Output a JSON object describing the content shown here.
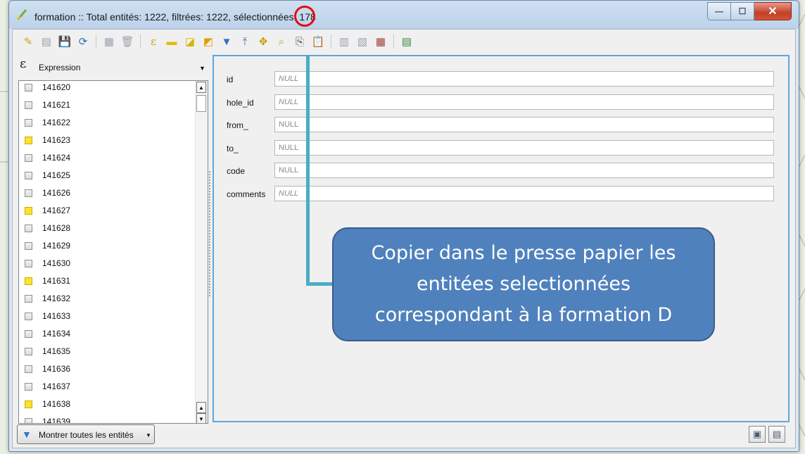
{
  "window": {
    "title": "formation :: Total entités: 1222, filtrées: 1222, sélectionnées: 178",
    "controls": {
      "minimize": "—",
      "maximize": "☐",
      "close": "✕"
    }
  },
  "toolbar": {
    "buttons": [
      {
        "name": "toggle-editing-icon",
        "glyph": "✎"
      },
      {
        "name": "multi-edit-icon",
        "glyph": "▤"
      },
      {
        "name": "save-edits-icon",
        "glyph": "💾"
      },
      {
        "name": "reload-icon",
        "glyph": "⟳"
      },
      {
        "name": "add-feature-icon",
        "glyph": "▦"
      },
      {
        "name": "delete-selected-icon",
        "glyph": "🗑"
      },
      {
        "name": "select-by-expression-icon",
        "glyph": "ε"
      },
      {
        "name": "select-all-icon",
        "glyph": "▬"
      },
      {
        "name": "invert-selection-icon",
        "glyph": "◪"
      },
      {
        "name": "deselect-all-icon",
        "glyph": "◩"
      },
      {
        "name": "filter-select-icon",
        "glyph": "▼"
      },
      {
        "name": "move-selection-to-top-icon",
        "glyph": "⤒"
      },
      {
        "name": "pan-map-to-selection-icon",
        "glyph": "✥"
      },
      {
        "name": "zoom-to-selection-icon",
        "glyph": "⌕"
      },
      {
        "name": "copy-selected-rows-icon",
        "glyph": "⎘"
      },
      {
        "name": "paste-features-icon",
        "glyph": "📋"
      },
      {
        "name": "new-field-icon",
        "glyph": "▥"
      },
      {
        "name": "delete-field-icon",
        "glyph": "▧"
      },
      {
        "name": "field-calculator-icon",
        "glyph": "▦"
      },
      {
        "name": "conditional-formatting-icon",
        "glyph": "▤"
      }
    ]
  },
  "left_panel": {
    "expression_label": "Expression",
    "items": [
      {
        "label": "141620",
        "selected": false
      },
      {
        "label": "141621",
        "selected": false
      },
      {
        "label": "141622",
        "selected": false
      },
      {
        "label": "141623",
        "selected": true
      },
      {
        "label": "141624",
        "selected": false
      },
      {
        "label": "141625",
        "selected": false
      },
      {
        "label": "141626",
        "selected": false
      },
      {
        "label": "141627",
        "selected": true
      },
      {
        "label": "141628",
        "selected": false
      },
      {
        "label": "141629",
        "selected": false
      },
      {
        "label": "141630",
        "selected": false
      },
      {
        "label": "141631",
        "selected": true
      },
      {
        "label": "141632",
        "selected": false
      },
      {
        "label": "141633",
        "selected": false
      },
      {
        "label": "141634",
        "selected": false
      },
      {
        "label": "141635",
        "selected": false
      },
      {
        "label": "141636",
        "selected": false
      },
      {
        "label": "141637",
        "selected": false
      },
      {
        "label": "141638",
        "selected": true
      },
      {
        "label": "141639",
        "selected": false
      }
    ]
  },
  "form": {
    "fields": [
      {
        "label": "id",
        "value": "NULL",
        "italic": true
      },
      {
        "label": "hole_id",
        "value": "NULL",
        "italic": true
      },
      {
        "label": "from_",
        "value": "NULL",
        "italic": false
      },
      {
        "label": "to_",
        "value": "NULL",
        "italic": false
      },
      {
        "label": "code",
        "value": "NULL",
        "italic": false
      },
      {
        "label": "comments",
        "value": "NULL",
        "italic": true
      }
    ]
  },
  "bottom": {
    "filter_button_label": "Montrer toutes les entités"
  },
  "callout": {
    "text": "Copier dans le presse papier les entitées selectionnées correspondant à la formation D"
  },
  "colors": {
    "callout_fill": "#4f81bd",
    "connector": "#4aacc5",
    "highlight_ring": "#e01010",
    "selected_checkbox": "#ffe22b"
  }
}
